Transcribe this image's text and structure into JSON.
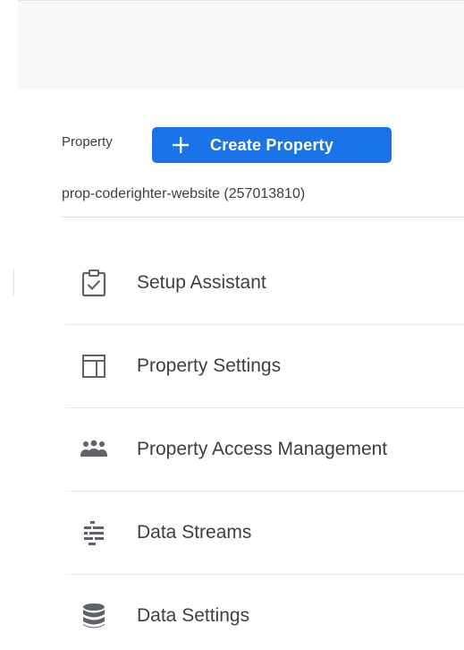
{
  "property_section": {
    "label": "Property",
    "create_button": {
      "icon": "plus-icon",
      "label": "Create Property"
    },
    "selected_property": "prop-coderighter-website (257013810)"
  },
  "menu": {
    "items": [
      {
        "icon": "clipboard-check-icon",
        "label": "Setup Assistant"
      },
      {
        "icon": "window-layout-icon",
        "label": "Property Settings"
      },
      {
        "icon": "people-group-icon",
        "label": "Property Access Management"
      },
      {
        "icon": "data-streams-icon",
        "label": "Data Streams"
      },
      {
        "icon": "database-icon",
        "label": "Data Settings"
      }
    ]
  },
  "colors": {
    "accent": "#1a73e8",
    "icon_gray": "#5f6368",
    "text": "#3c4043",
    "divider": "#e8eaed",
    "header_bg": "#f7f8fa"
  }
}
